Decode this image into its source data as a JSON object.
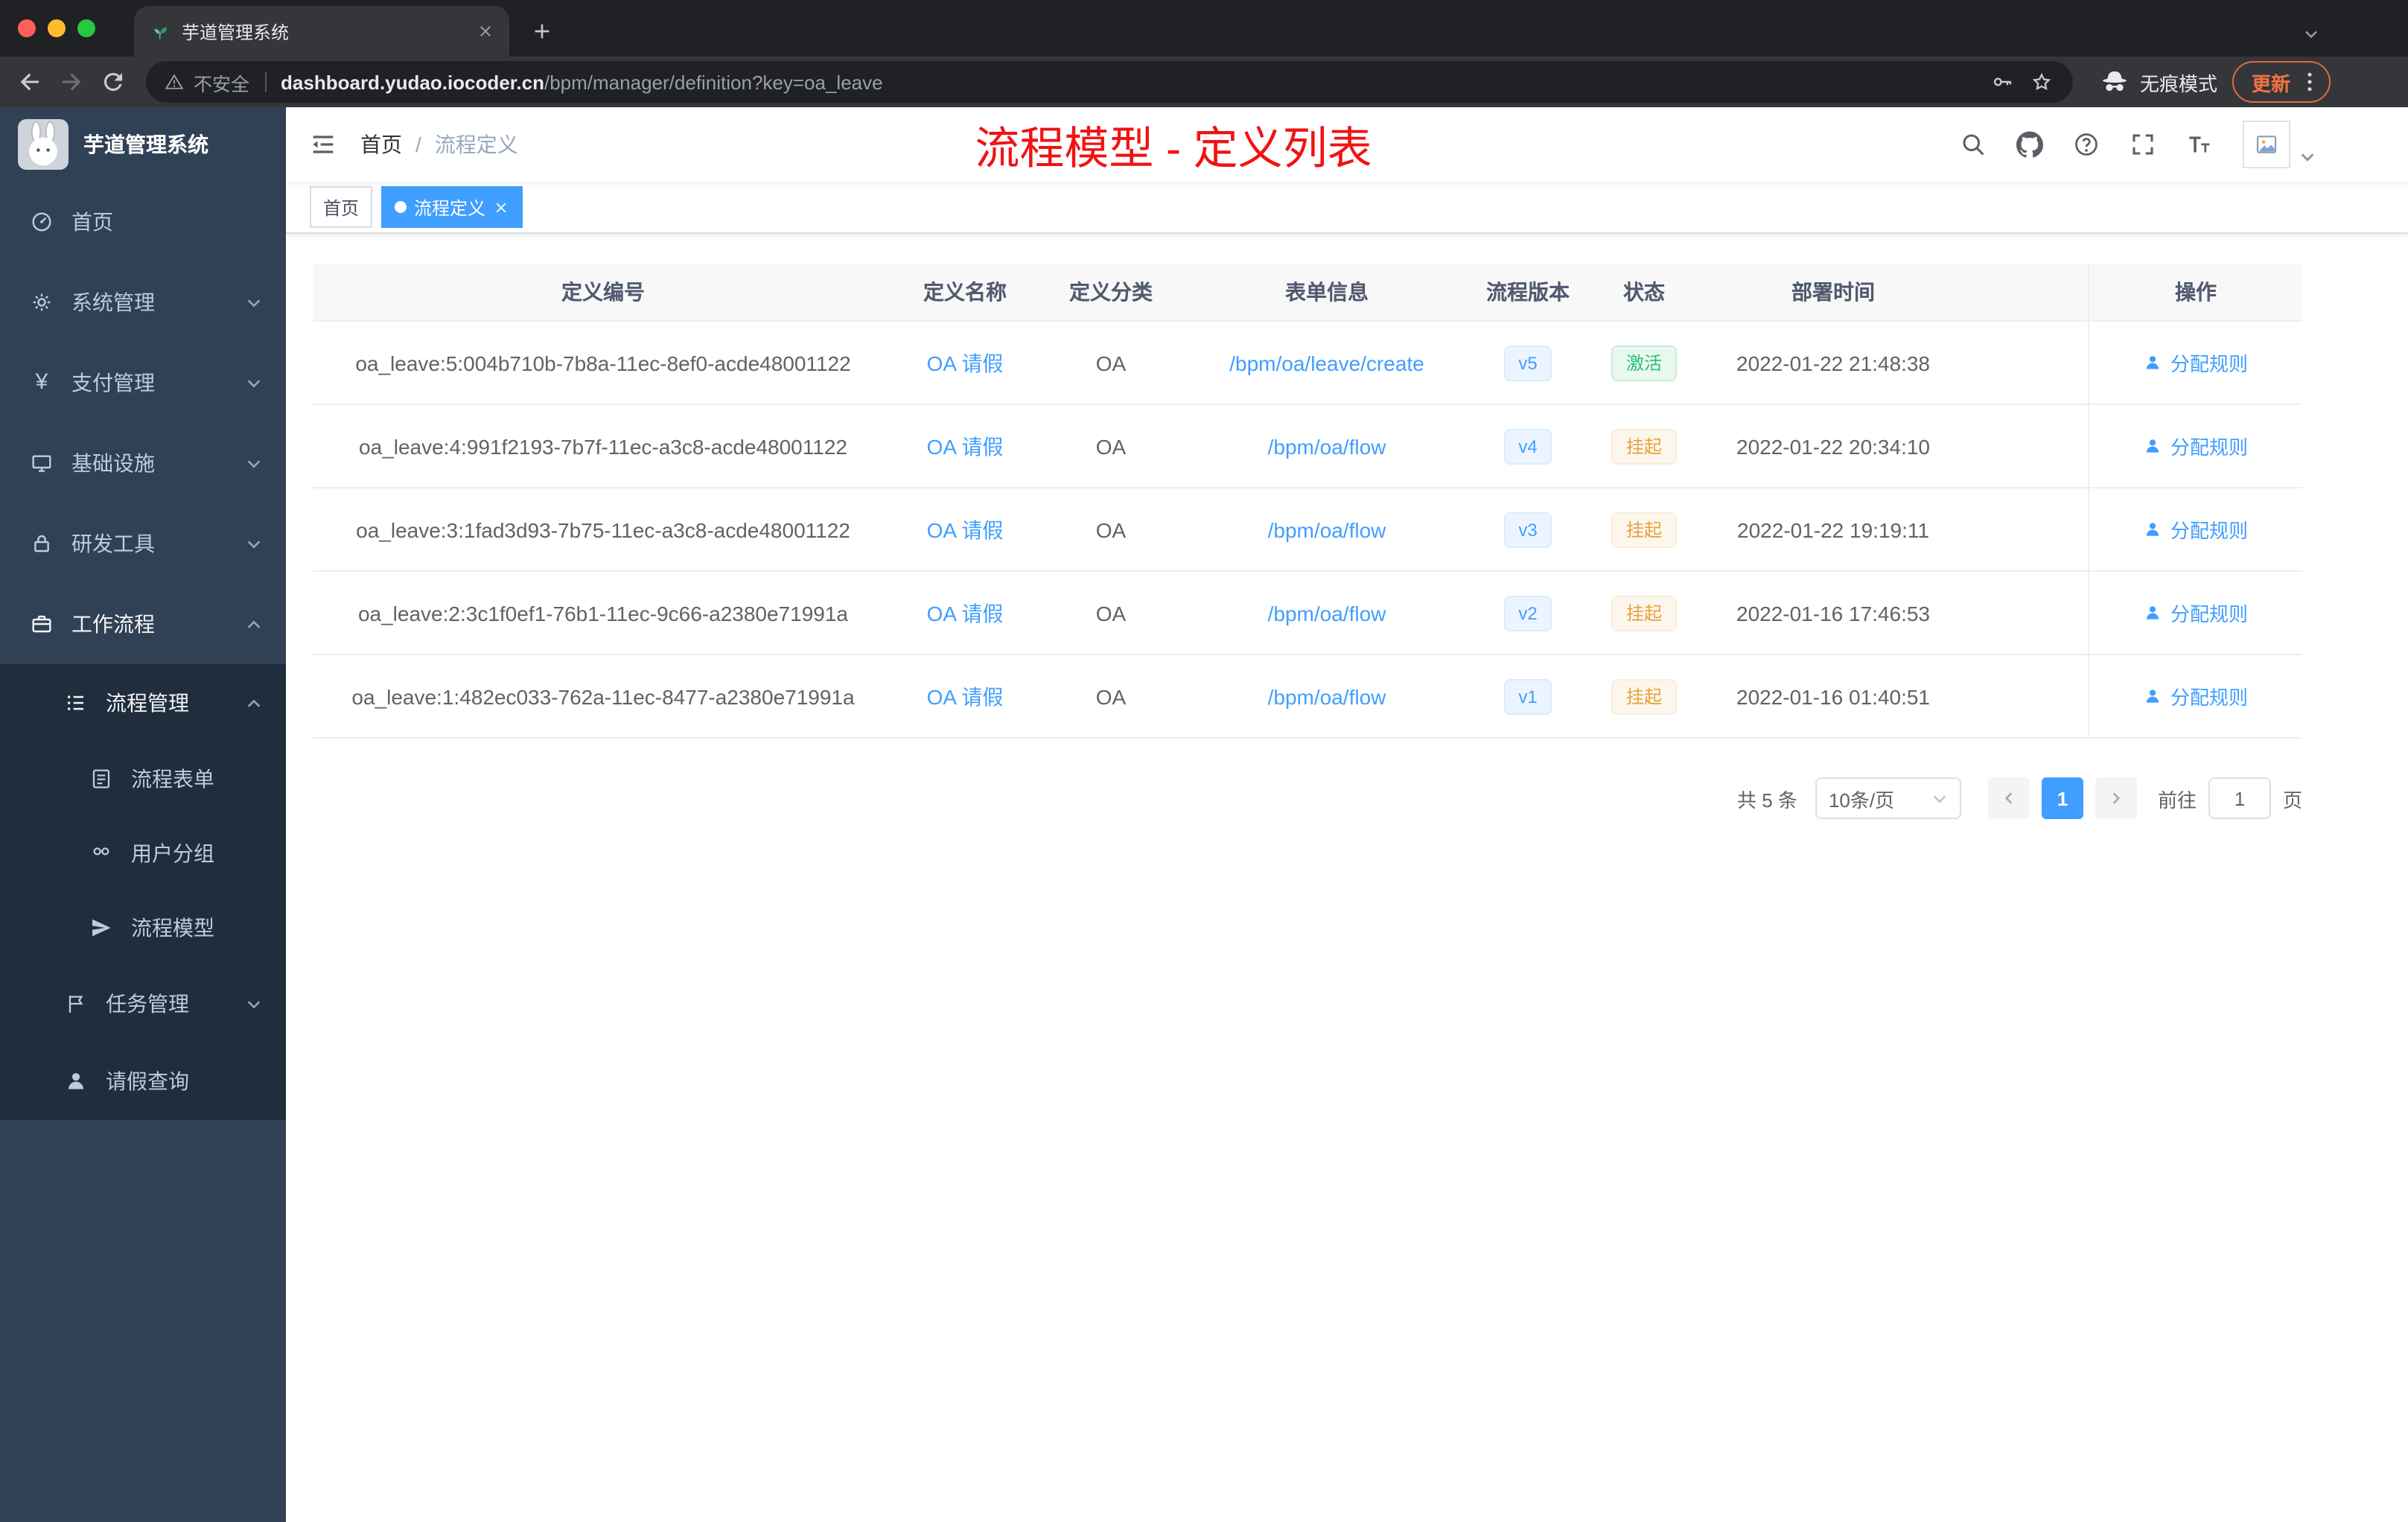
{
  "browser": {
    "tab_title": "芋道管理系统",
    "security_label": "不安全",
    "url_domain": "dashboard.yudao.iocoder.cn",
    "url_path": "/bpm/manager/definition?key=oa_leave",
    "incognito_label": "无痕模式",
    "update_label": "更新"
  },
  "sidebar": {
    "logo_title": "芋道管理系统",
    "items": {
      "home": "首页",
      "system": "系统管理",
      "payment": "支付管理",
      "infra": "基础设施",
      "devtools": "研发工具",
      "workflow": "工作流程",
      "process_mgmt": "流程管理",
      "process_form": "流程表单",
      "user_group": "用户分组",
      "process_model": "流程模型",
      "task_mgmt": "任务管理",
      "leave_query": "请假查询"
    }
  },
  "navbar": {
    "breadcrumb_home": "首页",
    "breadcrumb_sep": "/",
    "breadcrumb_current": "流程定义",
    "annotation": "流程模型 - 定义列表"
  },
  "tags": {
    "home": "首页",
    "active": "流程定义"
  },
  "table": {
    "columns": [
      "定义编号",
      "定义名称",
      "定义分类",
      "表单信息",
      "流程版本",
      "状态",
      "部署时间",
      "操作"
    ],
    "rows": [
      {
        "id": "oa_leave:5:004b710b-7b8a-11ec-8ef0-acde48001122",
        "name": "OA 请假",
        "category": "OA",
        "form": "/bpm/oa/leave/create",
        "version": "v5",
        "status": "激活",
        "time": "2022-01-22 21:48:38",
        "action": "分配规则"
      },
      {
        "id": "oa_leave:4:991f2193-7b7f-11ec-a3c8-acde48001122",
        "name": "OA 请假",
        "category": "OA",
        "form": "/bpm/oa/flow",
        "version": "v4",
        "status": "挂起",
        "time": "2022-01-22 20:34:10",
        "action": "分配规则"
      },
      {
        "id": "oa_leave:3:1fad3d93-7b75-11ec-a3c8-acde48001122",
        "name": "OA 请假",
        "category": "OA",
        "form": "/bpm/oa/flow",
        "version": "v3",
        "status": "挂起",
        "time": "2022-01-22 19:19:11",
        "action": "分配规则"
      },
      {
        "id": "oa_leave:2:3c1f0ef1-76b1-11ec-9c66-a2380e71991a",
        "name": "OA 请假",
        "category": "OA",
        "form": "/bpm/oa/flow",
        "version": "v2",
        "status": "挂起",
        "time": "2022-01-16 17:46:53",
        "action": "分配规则"
      },
      {
        "id": "oa_leave:1:482ec033-762a-11ec-8477-a2380e71991a",
        "name": "OA 请假",
        "category": "OA",
        "form": "/bpm/oa/flow",
        "version": "v1",
        "status": "挂起",
        "time": "2022-01-16 01:40:51",
        "action": "分配规则"
      }
    ]
  },
  "pagination": {
    "total": "共 5 条",
    "page_size": "10条/页",
    "current_page": "1",
    "goto_label": "前往",
    "goto_value": "1",
    "page_unit": "页"
  },
  "colors": {
    "accent": "#409eff",
    "success": "#2fbd75",
    "warning": "#e6a23c",
    "annotation_red": "#f21212",
    "sidebar_bg": "#304156",
    "submenu_bg": "#1f2d3d"
  }
}
